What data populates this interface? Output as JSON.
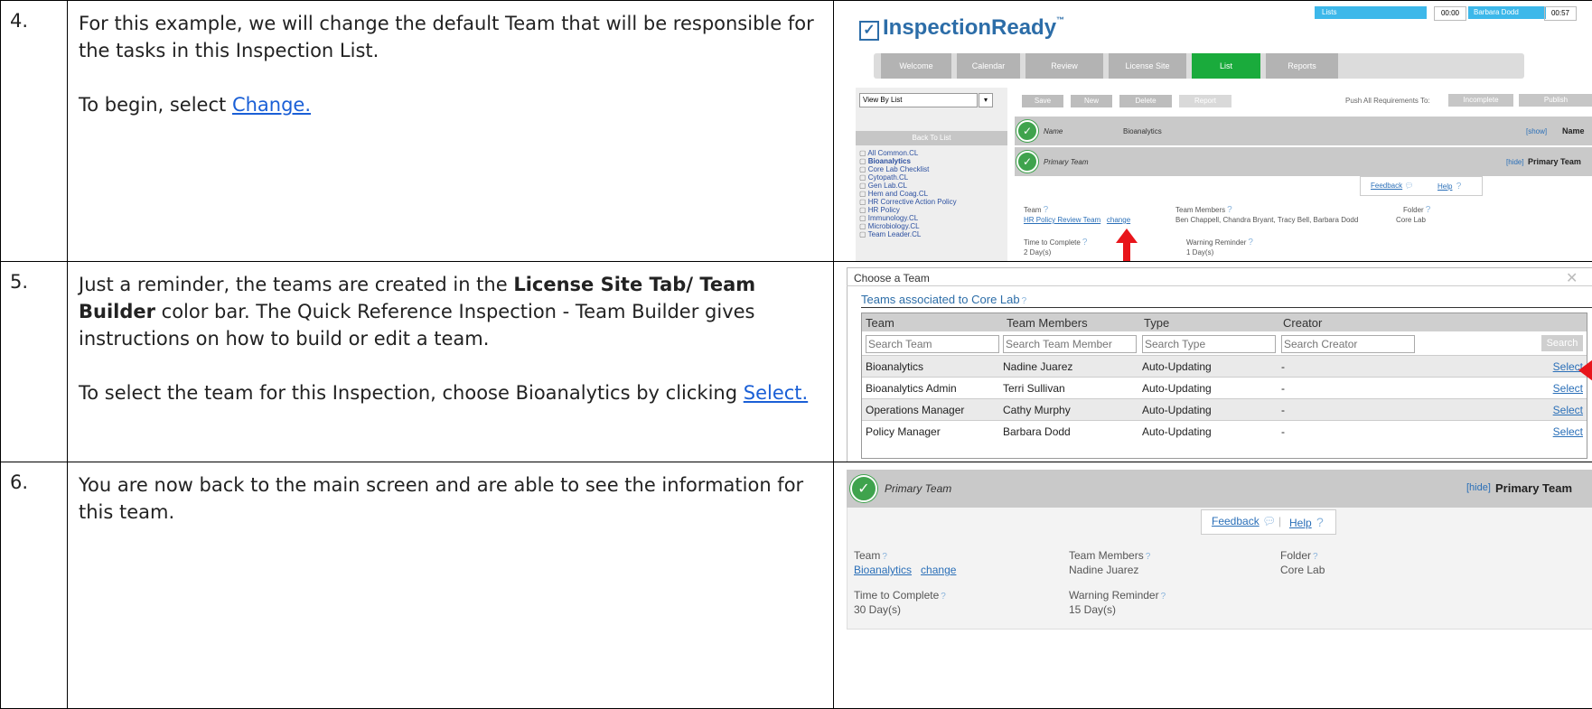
{
  "rows": [
    {
      "num": "4.",
      "para1": "For this example, we will change the default Team that will be responsible for the tasks in this Inspection List.",
      "para2_prefix": "To begin, select ",
      "para2_link": "Change."
    },
    {
      "num": "5.",
      "para1_pre": "Just a reminder, the teams are created in the ",
      "para1_bold": "License Site Tab/ Team Builder",
      "para1_post": " color bar.  The Quick Reference Inspection - Team Builder gives instructions on how to build or edit a team.",
      "para2_prefix": "To select the team for this Inspection, choose Bioanalytics by clicking ",
      "para2_link": "Select."
    },
    {
      "num": "6.",
      "para1": "You are now back to the main screen and are able to see the information for this team."
    }
  ],
  "shot1": {
    "logo": "InspectionReady",
    "tm": "™",
    "header_lists": "Lists",
    "timer1": "00:00",
    "user": "Barbara Dodd",
    "timer2": "00:57",
    "tabs": [
      "Welcome",
      "Calendar",
      "Review",
      "License Site",
      "List",
      "Reports"
    ],
    "view_select": "View By List",
    "toolbar": [
      "Save",
      "New",
      "Delete",
      "Report"
    ],
    "push_label": "Push All Requirements To:",
    "push_btn": "Incomplete",
    "publish": "Publish",
    "back": "Back To List",
    "tree": [
      "All Common.CL",
      "Bioanalytics",
      "Core Lab Checklist",
      "Cytopath.CL",
      "Gen Lab.CL",
      "Hem and Coag.CL",
      "HR Corrective Action Policy",
      "HR Policy",
      "Immunology.CL",
      "Microbiology.CL",
      "Team Leader.CL"
    ],
    "name_bar_label": "Name",
    "name_bar_value": "Bioanalytics",
    "show": "[show]",
    "name_right": "Name",
    "primary_label": "Primary Team",
    "hide": "[hide]",
    "primary_right": "Primary Team",
    "feedback": "Feedback",
    "help": "Help",
    "team_label": "Team",
    "team_value": "HR Policy Review Team",
    "change": "change",
    "members_label": "Team Members",
    "members_value": "Ben Chappell, Chandra Bryant, Tracy Bell, Barbara Dodd",
    "folder_label": "Folder",
    "folder_value": "Core Lab",
    "ttc_label": "Time to Complete",
    "ttc_value": "2 Day(s)",
    "warn_label": "Warning Reminder",
    "warn_value": "1 Day(s)"
  },
  "shot2": {
    "title": "Choose a Team",
    "close": "✕",
    "assoc": "Teams associated to  Core Lab",
    "headers": [
      "Team",
      "Team Members",
      "Type",
      "Creator"
    ],
    "placeholders": [
      "Search Team",
      "Search Team Member",
      "Search Type",
      "Search Creator"
    ],
    "search_btn": "Search",
    "rows": [
      {
        "team": "Bioanalytics",
        "members": "Nadine Juarez",
        "type": "Auto-Updating",
        "creator": "-",
        "action": "Select"
      },
      {
        "team": "Bioanalytics Admin",
        "members": "Terri Sullivan",
        "type": "Auto-Updating",
        "creator": "-",
        "action": "Select"
      },
      {
        "team": "Operations Manager",
        "members": "Cathy Murphy",
        "type": "Auto-Updating",
        "creator": "-",
        "action": "Select"
      },
      {
        "team": "Policy Manager",
        "members": "Barbara Dodd",
        "type": "Auto-Updating",
        "creator": "-",
        "action": "Select"
      }
    ]
  },
  "shot3": {
    "primary_label": "Primary Team",
    "hide": "[hide]",
    "primary_right": "Primary Team",
    "feedback": "Feedback",
    "help": "Help",
    "team_label": "Team",
    "team_value": "Bioanalytics",
    "change": "change",
    "members_label": "Team Members",
    "members_value": "Nadine Juarez",
    "folder_label": "Folder",
    "folder_value": "Core Lab",
    "ttc_label": "Time to Complete",
    "ttc_value": "30 Day(s)",
    "warn_label": "Warning Reminder",
    "warn_value": "15 Day(s)"
  },
  "colors": {
    "green": "#3fa34d",
    "tab_green": "#1aab3c",
    "tab_gray": "#b3b3b3",
    "link": "#2a6fb8",
    "arrow": "#e8151b",
    "header_blue": "#3db8ea"
  }
}
